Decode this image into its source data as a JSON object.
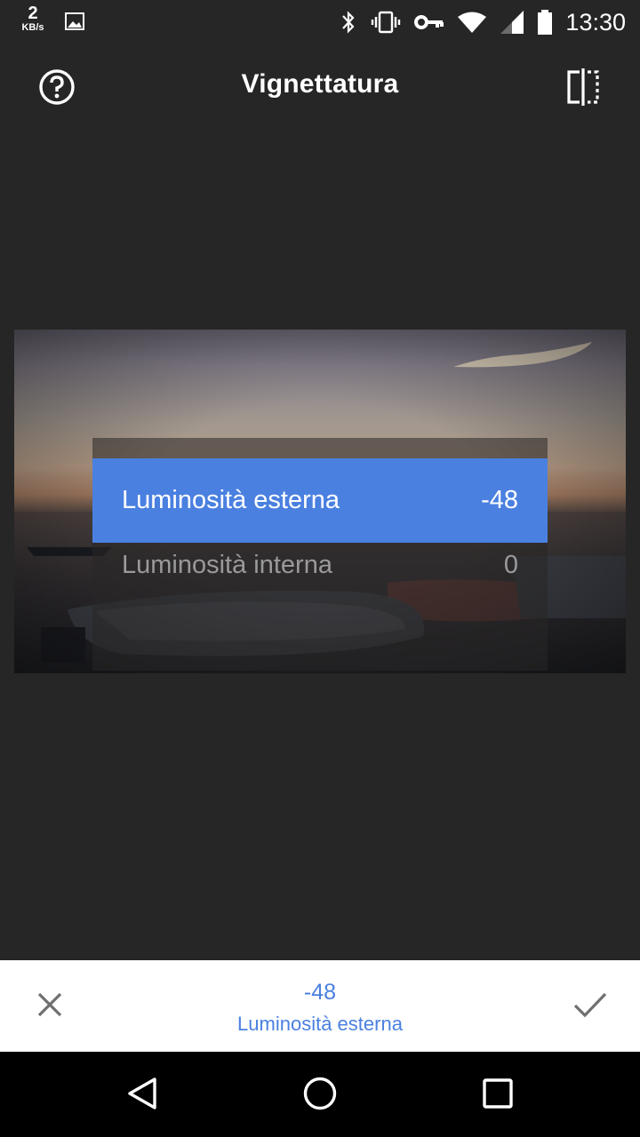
{
  "status_bar": {
    "net_speed_value": "2",
    "net_speed_unit": "KB/s",
    "time": "13:30",
    "icons": [
      "image-icon",
      "bluetooth-icon",
      "vibrate-icon",
      "vpn-key-icon",
      "wifi-icon",
      "cell-signal-icon",
      "battery-icon"
    ]
  },
  "app_bar": {
    "title": "Vignettatura",
    "help_icon": "help-circle-icon",
    "compare_icon": "compare-split-icon"
  },
  "parameters": {
    "items": [
      {
        "label": "Luminosità esterna",
        "value": "-48",
        "selected": true
      },
      {
        "label": "Luminosità interna",
        "value": "0",
        "selected": false
      }
    ]
  },
  "action_bar": {
    "value": "-48",
    "label": "Luminosità esterna",
    "cancel_icon": "close-icon",
    "apply_icon": "check-icon"
  },
  "nav_bar": {
    "icons": [
      "back-triangle-icon",
      "home-circle-icon",
      "recents-square-icon"
    ]
  },
  "colors": {
    "background": "#262626",
    "accent": "#4a80e0",
    "action_bar_bg": "#ffffff"
  }
}
